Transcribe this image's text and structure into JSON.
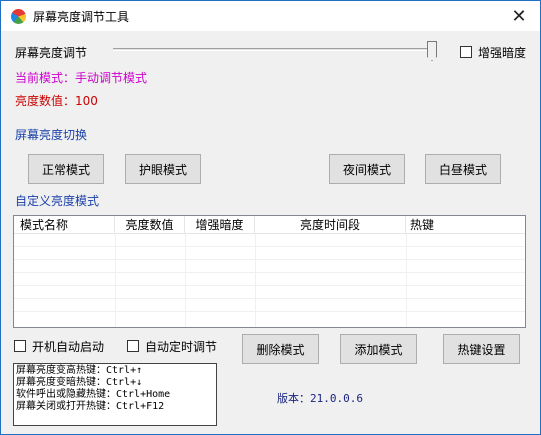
{
  "window": {
    "title": "屏幕亮度调节工具",
    "close_glyph": "✕"
  },
  "brightness": {
    "slider_label": "屏幕亮度调节",
    "slider_value_fraction": 1.0,
    "enhance_dark_label": "增强暗度",
    "current_mode_text": "当前模式：手动调节模式",
    "value_text": "亮度数值：100"
  },
  "switch_section": {
    "title": "屏幕亮度切换",
    "buttons": [
      "正常模式",
      "护眼模式",
      "夜间模式",
      "白昼模式"
    ]
  },
  "custom_section": {
    "title": "自定义亮度模式",
    "columns": [
      "模式名称",
      "亮度数值",
      "增强暗度",
      "亮度时间段",
      "热键"
    ]
  },
  "options": {
    "autostart_label": "开机自动启动",
    "auto_schedule_label": "自动定时调节"
  },
  "actions": {
    "delete": "删除模式",
    "add": "添加模式",
    "hotkey": "热键设置"
  },
  "hotkeys": [
    "屏幕亮度变高热键：Ctrl+↑",
    "屏幕亮度变暗热键：Ctrl+↓",
    "软件呼出或隐藏热键：Ctrl+Home",
    "屏幕关闭或打开热键：Ctrl+F12"
  ],
  "version_text": "版本：21.0.0.6",
  "colors": {
    "mode_text": "#cc00cc",
    "value_text": "#cc0000",
    "section_title": "#1a3fa8",
    "version": "#1a237e"
  }
}
